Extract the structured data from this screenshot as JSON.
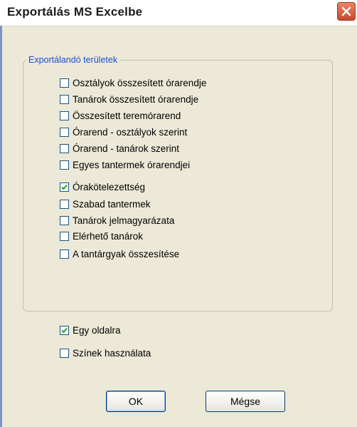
{
  "window": {
    "title": "Exportálás MS Excelbe"
  },
  "group": {
    "legend": "Exportálandó területek",
    "items": [
      {
        "label": "Osztályok összesített órarendje",
        "checked": false
      },
      {
        "label": "Tanárok összesített órarendje",
        "checked": false
      },
      {
        "label": "Összesített teremórarend",
        "checked": false
      },
      {
        "label": "Órarend - osztályok szerint",
        "checked": false
      },
      {
        "label": "Órarend - tanárok szerint",
        "checked": false
      },
      {
        "label": "Egyes tantermek órarendjei",
        "checked": false
      },
      {
        "label": "Órakötelezettség",
        "checked": true
      },
      {
        "label": "Szabad tantermek",
        "checked": false
      },
      {
        "label": "Tanárok jelmagyarázata",
        "checked": false
      },
      {
        "label": "Elérhető tanárok",
        "checked": false
      },
      {
        "label": "A tantárgyak összesítése",
        "checked": false
      }
    ]
  },
  "options": [
    {
      "label": "Egy oldalra",
      "checked": true
    },
    {
      "label": "Színek használata",
      "checked": false
    }
  ],
  "buttons": {
    "ok": "OK",
    "cancel": "Mégse"
  },
  "colors": {
    "title_bar": "#ffffff",
    "legend": "#1b4fd0",
    "close_button": "#d2593c",
    "check_mark": "#21a121"
  }
}
